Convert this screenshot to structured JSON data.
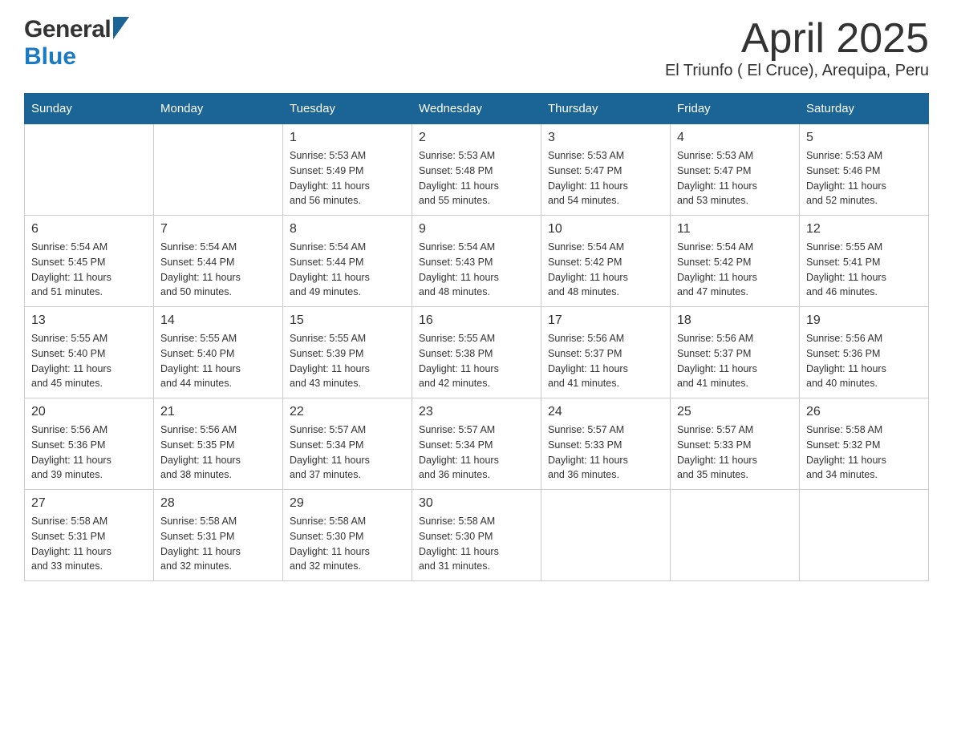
{
  "header": {
    "title": "April 2025",
    "subtitle": "El Triunfo ( El Cruce), Arequipa, Peru",
    "logo_general": "General",
    "logo_blue": "Blue"
  },
  "calendar": {
    "days_of_week": [
      "Sunday",
      "Monday",
      "Tuesday",
      "Wednesday",
      "Thursday",
      "Friday",
      "Saturday"
    ],
    "weeks": [
      [
        {
          "day": "",
          "info": ""
        },
        {
          "day": "",
          "info": ""
        },
        {
          "day": "1",
          "info": "Sunrise: 5:53 AM\nSunset: 5:49 PM\nDaylight: 11 hours\nand 56 minutes."
        },
        {
          "day": "2",
          "info": "Sunrise: 5:53 AM\nSunset: 5:48 PM\nDaylight: 11 hours\nand 55 minutes."
        },
        {
          "day": "3",
          "info": "Sunrise: 5:53 AM\nSunset: 5:47 PM\nDaylight: 11 hours\nand 54 minutes."
        },
        {
          "day": "4",
          "info": "Sunrise: 5:53 AM\nSunset: 5:47 PM\nDaylight: 11 hours\nand 53 minutes."
        },
        {
          "day": "5",
          "info": "Sunrise: 5:53 AM\nSunset: 5:46 PM\nDaylight: 11 hours\nand 52 minutes."
        }
      ],
      [
        {
          "day": "6",
          "info": "Sunrise: 5:54 AM\nSunset: 5:45 PM\nDaylight: 11 hours\nand 51 minutes."
        },
        {
          "day": "7",
          "info": "Sunrise: 5:54 AM\nSunset: 5:44 PM\nDaylight: 11 hours\nand 50 minutes."
        },
        {
          "day": "8",
          "info": "Sunrise: 5:54 AM\nSunset: 5:44 PM\nDaylight: 11 hours\nand 49 minutes."
        },
        {
          "day": "9",
          "info": "Sunrise: 5:54 AM\nSunset: 5:43 PM\nDaylight: 11 hours\nand 48 minutes."
        },
        {
          "day": "10",
          "info": "Sunrise: 5:54 AM\nSunset: 5:42 PM\nDaylight: 11 hours\nand 48 minutes."
        },
        {
          "day": "11",
          "info": "Sunrise: 5:54 AM\nSunset: 5:42 PM\nDaylight: 11 hours\nand 47 minutes."
        },
        {
          "day": "12",
          "info": "Sunrise: 5:55 AM\nSunset: 5:41 PM\nDaylight: 11 hours\nand 46 minutes."
        }
      ],
      [
        {
          "day": "13",
          "info": "Sunrise: 5:55 AM\nSunset: 5:40 PM\nDaylight: 11 hours\nand 45 minutes."
        },
        {
          "day": "14",
          "info": "Sunrise: 5:55 AM\nSunset: 5:40 PM\nDaylight: 11 hours\nand 44 minutes."
        },
        {
          "day": "15",
          "info": "Sunrise: 5:55 AM\nSunset: 5:39 PM\nDaylight: 11 hours\nand 43 minutes."
        },
        {
          "day": "16",
          "info": "Sunrise: 5:55 AM\nSunset: 5:38 PM\nDaylight: 11 hours\nand 42 minutes."
        },
        {
          "day": "17",
          "info": "Sunrise: 5:56 AM\nSunset: 5:37 PM\nDaylight: 11 hours\nand 41 minutes."
        },
        {
          "day": "18",
          "info": "Sunrise: 5:56 AM\nSunset: 5:37 PM\nDaylight: 11 hours\nand 41 minutes."
        },
        {
          "day": "19",
          "info": "Sunrise: 5:56 AM\nSunset: 5:36 PM\nDaylight: 11 hours\nand 40 minutes."
        }
      ],
      [
        {
          "day": "20",
          "info": "Sunrise: 5:56 AM\nSunset: 5:36 PM\nDaylight: 11 hours\nand 39 minutes."
        },
        {
          "day": "21",
          "info": "Sunrise: 5:56 AM\nSunset: 5:35 PM\nDaylight: 11 hours\nand 38 minutes."
        },
        {
          "day": "22",
          "info": "Sunrise: 5:57 AM\nSunset: 5:34 PM\nDaylight: 11 hours\nand 37 minutes."
        },
        {
          "day": "23",
          "info": "Sunrise: 5:57 AM\nSunset: 5:34 PM\nDaylight: 11 hours\nand 36 minutes."
        },
        {
          "day": "24",
          "info": "Sunrise: 5:57 AM\nSunset: 5:33 PM\nDaylight: 11 hours\nand 36 minutes."
        },
        {
          "day": "25",
          "info": "Sunrise: 5:57 AM\nSunset: 5:33 PM\nDaylight: 11 hours\nand 35 minutes."
        },
        {
          "day": "26",
          "info": "Sunrise: 5:58 AM\nSunset: 5:32 PM\nDaylight: 11 hours\nand 34 minutes."
        }
      ],
      [
        {
          "day": "27",
          "info": "Sunrise: 5:58 AM\nSunset: 5:31 PM\nDaylight: 11 hours\nand 33 minutes."
        },
        {
          "day": "28",
          "info": "Sunrise: 5:58 AM\nSunset: 5:31 PM\nDaylight: 11 hours\nand 32 minutes."
        },
        {
          "day": "29",
          "info": "Sunrise: 5:58 AM\nSunset: 5:30 PM\nDaylight: 11 hours\nand 32 minutes."
        },
        {
          "day": "30",
          "info": "Sunrise: 5:58 AM\nSunset: 5:30 PM\nDaylight: 11 hours\nand 31 minutes."
        },
        {
          "day": "",
          "info": ""
        },
        {
          "day": "",
          "info": ""
        },
        {
          "day": "",
          "info": ""
        }
      ]
    ]
  }
}
